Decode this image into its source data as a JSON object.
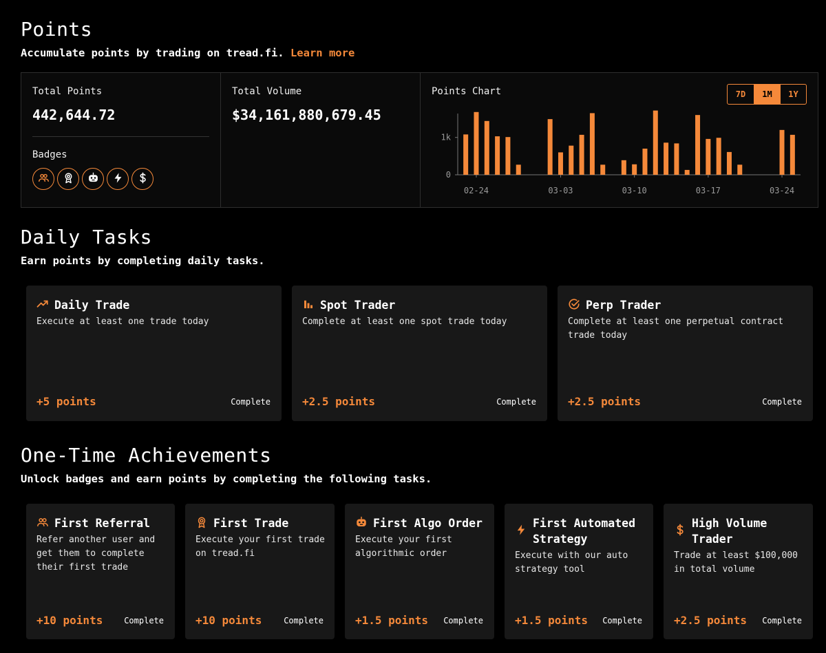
{
  "points_section": {
    "title": "Points",
    "subtitle": "Accumulate points by trading on tread.fi.",
    "learn_more": "Learn more"
  },
  "summary": {
    "total_points_label": "Total Points",
    "total_points_value": "442,644.72",
    "badges_label": "Badges",
    "badges": [
      {
        "icon": "users-icon"
      },
      {
        "icon": "award-icon"
      },
      {
        "icon": "robot-icon"
      },
      {
        "icon": "lightning-icon"
      },
      {
        "icon": "dollar-icon"
      }
    ],
    "total_volume_label": "Total Volume",
    "total_volume_value": "$34,161,880,679.45",
    "chart_label": "Points Chart",
    "ranges": [
      "7D",
      "1M",
      "1Y"
    ],
    "active_range": "1M"
  },
  "chart_data": {
    "type": "bar",
    "title": "Points Chart",
    "color": "#f5893a",
    "y_ticks": [
      "0",
      "1k"
    ],
    "ylim": [
      0,
      1750
    ],
    "x_tick_labels": [
      "02-24",
      "03-03",
      "03-10",
      "03-17",
      "03-24"
    ],
    "categories": [
      "02-23",
      "02-24",
      "02-25",
      "02-26",
      "02-27",
      "02-28",
      "02-29",
      "03-01",
      "03-02",
      "03-03",
      "03-04",
      "03-05",
      "03-06",
      "03-07",
      "03-08",
      "03-09",
      "03-10",
      "03-11",
      "03-12",
      "03-13",
      "03-14",
      "03-15",
      "03-16",
      "03-17",
      "03-18",
      "03-19",
      "03-20",
      "03-21",
      "03-22",
      "03-23",
      "03-24",
      "03-25"
    ],
    "values": [
      1080,
      1680,
      1440,
      1030,
      1010,
      270,
      0,
      0,
      1490,
      600,
      780,
      1070,
      1650,
      270,
      0,
      390,
      280,
      700,
      1720,
      860,
      840,
      130,
      1600,
      960,
      990,
      610,
      270,
      0,
      0,
      0,
      1200,
      1070
    ]
  },
  "daily_section": {
    "title": "Daily Tasks",
    "subtitle": "Earn points by completing daily tasks.",
    "tasks": [
      {
        "icon": "trending-up-icon",
        "title": "Daily Trade",
        "description": "Execute at least one trade today",
        "points": "+5 points",
        "status": "Complete"
      },
      {
        "icon": "bar-chart-icon",
        "title": "Spot Trader",
        "description": "Complete at least one spot trade today",
        "points": "+2.5 points",
        "status": "Complete"
      },
      {
        "icon": "check-circle-icon",
        "title": "Perp Trader",
        "description": "Complete at least one perpetual contract trade today",
        "points": "+2.5 points",
        "status": "Complete"
      }
    ]
  },
  "achievements_section": {
    "title": "One-Time Achievements",
    "subtitle": "Unlock badges and earn points by completing the following tasks.",
    "items": [
      {
        "icon": "users-icon",
        "title": "First Referral",
        "description": "Refer another user and get them to complete their first trade",
        "points": "+10 points",
        "status": "Complete"
      },
      {
        "icon": "award-icon",
        "title": "First Trade",
        "description": "Execute your first trade on tread.fi",
        "points": "+10 points",
        "status": "Complete"
      },
      {
        "icon": "robot-icon",
        "title": "First Algo Order",
        "description": "Execute your first algorithmic order",
        "points": "+1.5 points",
        "status": "Complete"
      },
      {
        "icon": "lightning-icon",
        "title": "First Automated Strategy",
        "description": "Execute with our auto strategy tool",
        "points": "+1.5 points",
        "status": "Complete"
      },
      {
        "icon": "dollar-icon",
        "title": "High Volume Trader",
        "description": "Trade at least $100,000 in total volume",
        "points": "+2.5 points",
        "status": "Complete"
      }
    ]
  }
}
